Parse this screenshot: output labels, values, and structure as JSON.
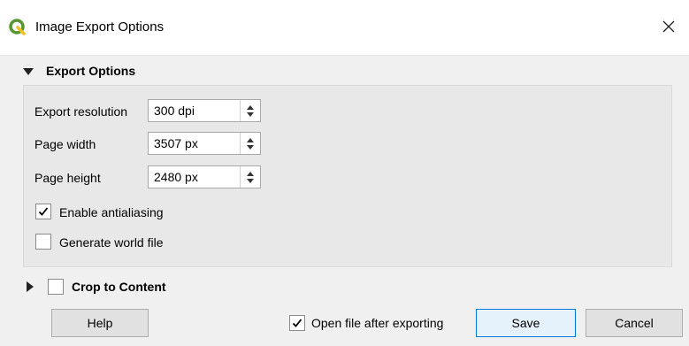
{
  "window": {
    "title": "Image Export Options",
    "icon": "qgis-logo-icon",
    "close_glyph": "✕"
  },
  "export_options": {
    "section_title": "Export Options",
    "resolution": {
      "label": "Export resolution",
      "value": "300 dpi"
    },
    "page_width": {
      "label": "Page width",
      "value": "3507 px"
    },
    "page_height": {
      "label": "Page height",
      "value": "2480 px"
    },
    "antialiasing": {
      "label": "Enable antialiasing",
      "checked": true
    },
    "world_file": {
      "label": "Generate world file",
      "checked": false
    }
  },
  "crop": {
    "label": "Crop to Content",
    "checked": false,
    "expanded": false
  },
  "footer": {
    "help_label": "Help",
    "open_after": {
      "label": "Open file after exporting",
      "checked": true
    },
    "save_label": "Save",
    "cancel_label": "Cancel"
  },
  "colors": {
    "dialog_bg": "#f0f0f0",
    "titlebar_bg": "#ffffff",
    "group_bg": "#e8e8e8",
    "primary_border": "#0078d7",
    "logo_green": "#589632"
  }
}
